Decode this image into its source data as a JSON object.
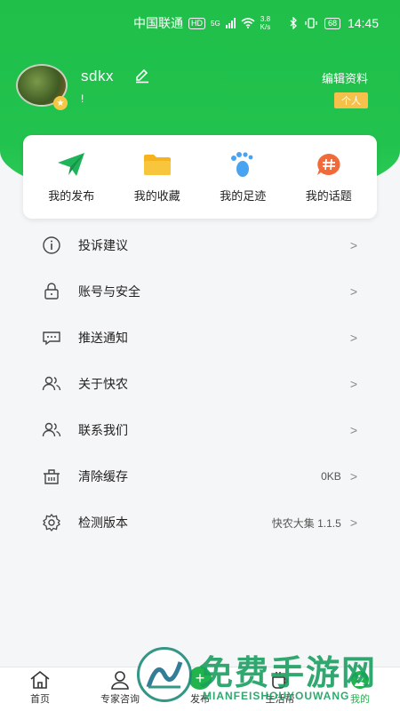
{
  "status_bar": {
    "carrier": "中国联通",
    "hd": "HD",
    "network": "5G",
    "speed_value": "3.8",
    "speed_unit": "K/s",
    "battery": "68",
    "time": "14:45"
  },
  "profile": {
    "username": "sdkx",
    "signature": "!",
    "edit_profile_label": "编辑资料",
    "account_type_badge": "个人"
  },
  "quick_actions": [
    {
      "label": "我的发布",
      "icon": "paper-plane-icon",
      "color": "#1fb45a"
    },
    {
      "label": "我的收藏",
      "icon": "folder-icon",
      "color": "#f5b41e"
    },
    {
      "label": "我的足迹",
      "icon": "footprint-icon",
      "color": "#4aa3f0"
    },
    {
      "label": "我的话题",
      "icon": "hashtag-bubble-icon",
      "color": "#f06a3a"
    }
  ],
  "menu": [
    {
      "label": "投诉建议",
      "icon": "info-icon",
      "value": ""
    },
    {
      "label": "账号与安全",
      "icon": "lock-icon",
      "value": ""
    },
    {
      "label": "推送通知",
      "icon": "message-icon",
      "value": ""
    },
    {
      "label": "关于快农",
      "icon": "users-icon",
      "value": ""
    },
    {
      "label": "联系我们",
      "icon": "users-icon",
      "value": ""
    },
    {
      "label": "清除缓存",
      "icon": "trash-icon",
      "value": "0KB"
    },
    {
      "label": "检测版本",
      "icon": "gear-icon",
      "value": "快农大集 1.1.5"
    }
  ],
  "bottom_nav": [
    {
      "label": "首页",
      "icon": "home-icon",
      "active": false
    },
    {
      "label": "专家咨询",
      "icon": "expert-icon",
      "active": false
    },
    {
      "label": "发布",
      "icon": "plus-icon",
      "active": false
    },
    {
      "label": "生活帮",
      "icon": "cup-icon",
      "active": false
    },
    {
      "label": "我的",
      "icon": "user-icon",
      "active": true
    }
  ],
  "watermark": {
    "title": "免费手游网",
    "subtitle": "MIANFEISHOUYOUWANG"
  },
  "colors": {
    "primary_green": "#22c24e",
    "badge_yellow": "#f5c14a",
    "active_green": "#22b44c"
  }
}
